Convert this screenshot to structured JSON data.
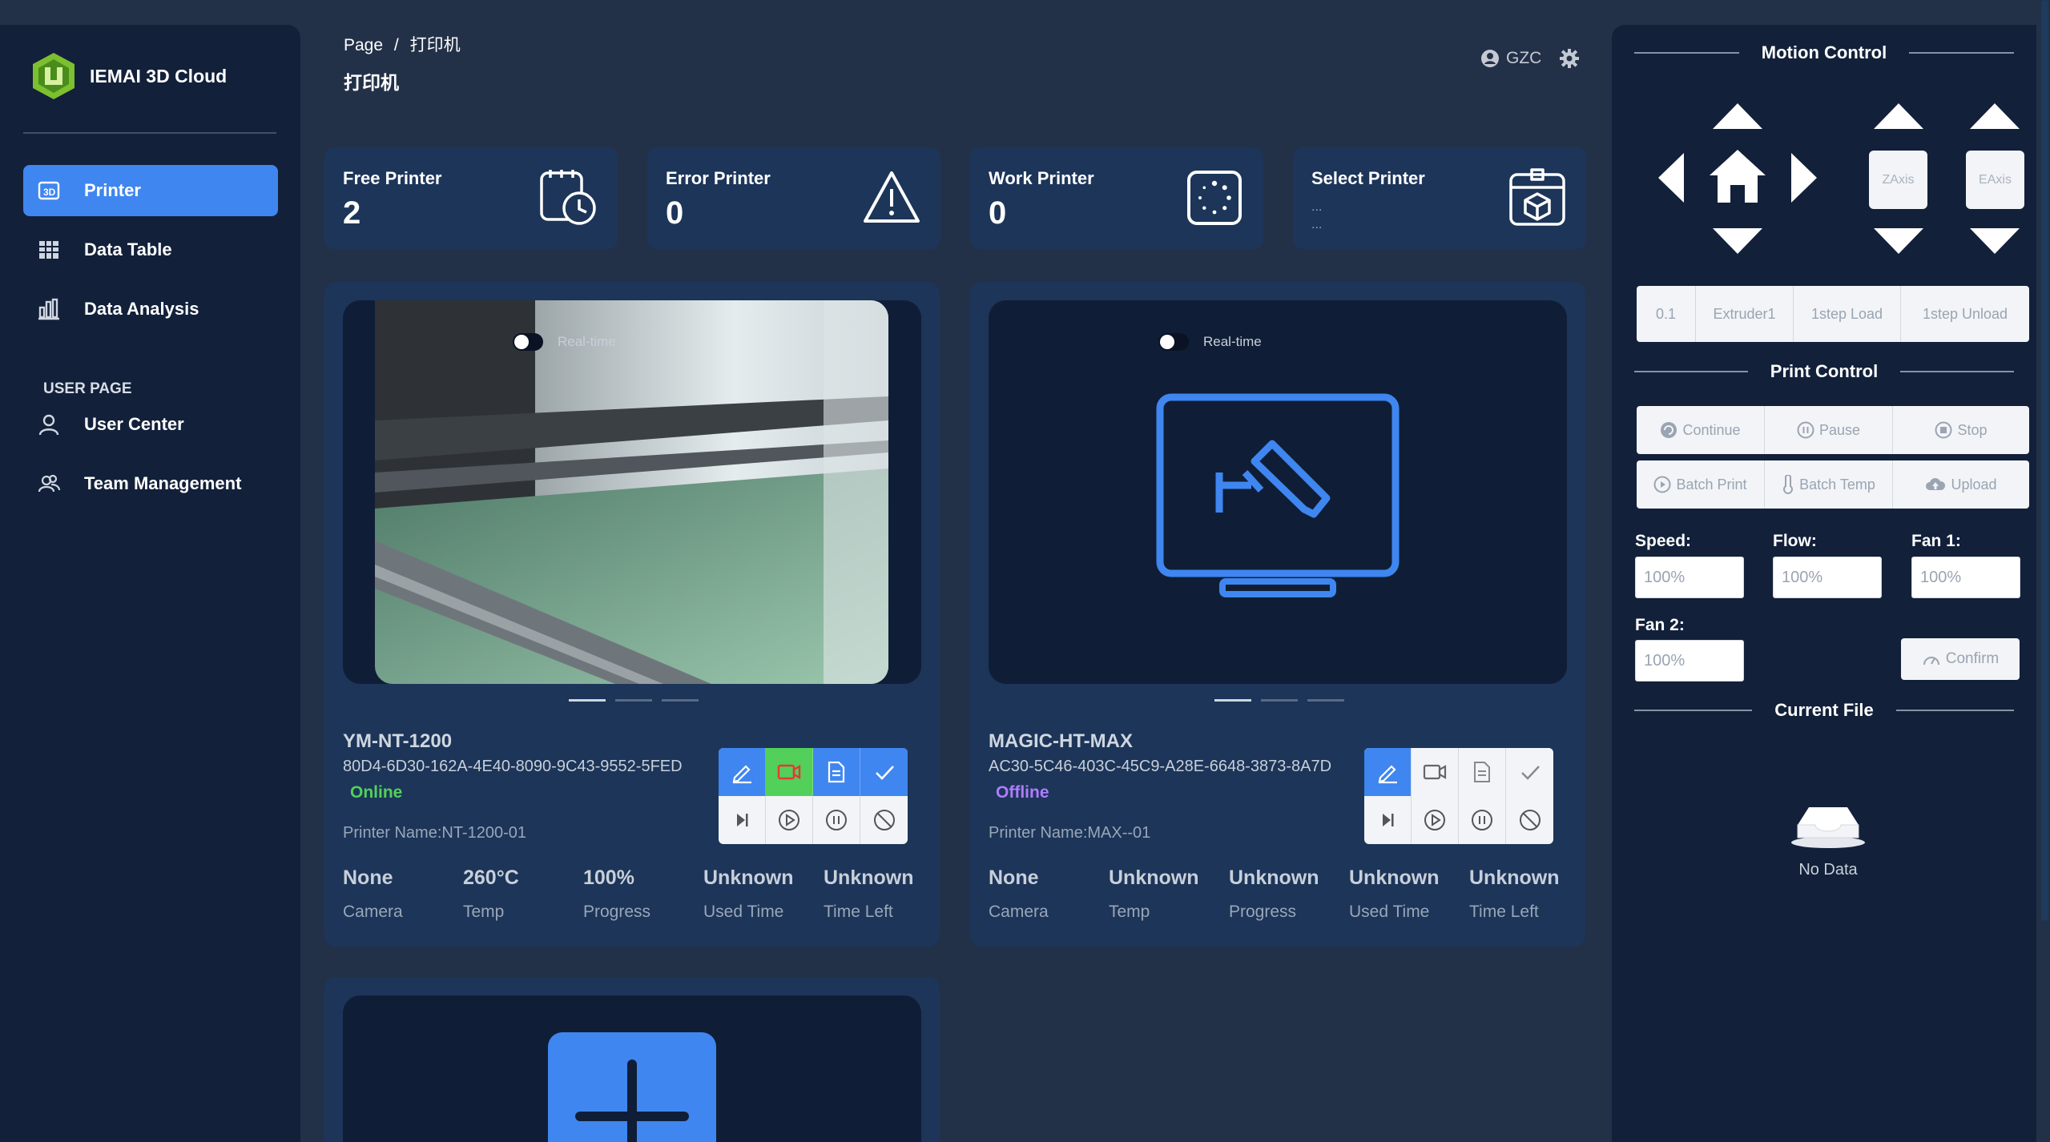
{
  "app": {
    "brand": "IEMAI 3D Cloud"
  },
  "sidebar": {
    "items": [
      {
        "label": "Printer",
        "icon": "printer-icon"
      },
      {
        "label": "Data Table",
        "icon": "table-icon"
      },
      {
        "label": "Data Analysis",
        "icon": "chart-icon"
      }
    ],
    "section_label": "USER PAGE",
    "user_items": [
      {
        "label": "User Center",
        "icon": "user-icon"
      },
      {
        "label": "Team Management",
        "icon": "team-icon"
      }
    ]
  },
  "header": {
    "breadcrumb_root": "Page",
    "breadcrumb_sep": "/",
    "breadcrumb_current": "打印机",
    "title": "打印机",
    "user": "GZC"
  },
  "stats": [
    {
      "label": "Free Printer",
      "value": "2"
    },
    {
      "label": "Error Printer",
      "value": "0"
    },
    {
      "label": "Work Printer",
      "value": "0"
    },
    {
      "label": "Select Printer",
      "value_line1": "...",
      "value_line2": "..."
    }
  ],
  "printers": [
    {
      "name": "YM-NT-1200",
      "id": "80D4-6D30-162A-4E40-8090-9C43-9552-5FED",
      "status": "Online",
      "status_color": "#52d05a",
      "printer_name": "Printer Name:NT-1200-01",
      "realtime_label": "Real-time",
      "metrics": [
        {
          "value": "None",
          "label": "Camera"
        },
        {
          "value": "260°C",
          "label": "Temp"
        },
        {
          "value": "100%",
          "label": "Progress"
        },
        {
          "value": "Unknown",
          "label": "Used Time"
        },
        {
          "value": "Unknown",
          "label": "Time Left"
        }
      ]
    },
    {
      "name": "MAGIC-HT-MAX",
      "id": "AC30-5C46-403C-45C9-A28E-6648-3873-8A7D",
      "status": "Offline",
      "status_color": "#b07cff",
      "printer_name": "Printer Name:MAX--01",
      "realtime_label": "Real-time",
      "metrics": [
        {
          "value": "None",
          "label": "Camera"
        },
        {
          "value": "Unknown",
          "label": "Temp"
        },
        {
          "value": "Unknown",
          "label": "Progress"
        },
        {
          "value": "Unknown",
          "label": "Used Time"
        },
        {
          "value": "Unknown",
          "label": "Time Left"
        }
      ]
    }
  ],
  "right": {
    "motion_title": "Motion Control",
    "zaxis": "ZAxis",
    "eaxis": "EAxis",
    "step_buttons": [
      "0.1",
      "Extruder1",
      "1step Load",
      "1step Unload"
    ],
    "print_title": "Print Control",
    "print_row1": [
      "Continue",
      "Pause",
      "Stop"
    ],
    "print_row2": [
      "Batch Print",
      "Batch Temp",
      "Upload"
    ],
    "speed_label": "Speed:",
    "speed": "100%",
    "flow_label": "Flow:",
    "flow": "100%",
    "fan1_label": "Fan 1:",
    "fan1": "100%",
    "fan2_label": "Fan 2:",
    "fan2": "100%",
    "confirm": "Confirm",
    "file_title": "Current File",
    "no_data": "No Data"
  },
  "colors": {
    "accent": "#3f86f0",
    "online": "#52d05a",
    "offline": "#b07cff",
    "panel": "#1c3559",
    "bg": "#233148"
  }
}
